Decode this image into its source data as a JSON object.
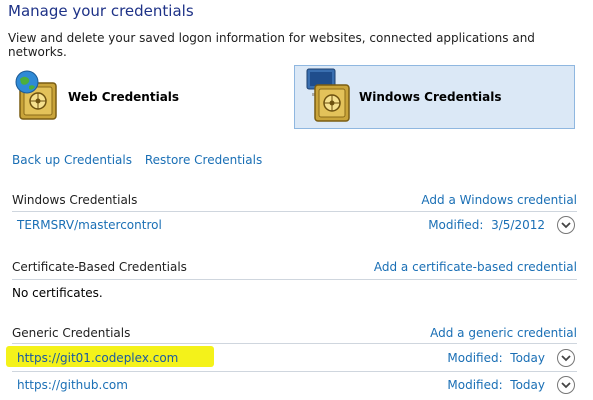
{
  "header": {
    "title": "Manage your credentials",
    "subtitle": "View and delete your saved logon information for websites, connected applications and networks."
  },
  "types": {
    "web_label": "Web Credentials",
    "windows_label": "Windows Credentials"
  },
  "actions": {
    "backup": "Back up Credentials",
    "restore": "Restore Credentials"
  },
  "sections": {
    "windows": {
      "heading": "Windows Credentials",
      "add_link": "Add a Windows credential",
      "items": [
        {
          "name": "TERMSRV/mastercontrol",
          "modified_label": "Modified:",
          "modified_value": "3/5/2012"
        }
      ]
    },
    "certificate": {
      "heading": "Certificate-Based Credentials",
      "add_link": "Add a certificate-based credential",
      "empty_text": "No certificates."
    },
    "generic": {
      "heading": "Generic Credentials",
      "add_link": "Add a generic credential",
      "items": [
        {
          "name": "https://git01.codeplex.com",
          "modified_label": "Modified:",
          "modified_value": "Today"
        },
        {
          "name": "https://github.com",
          "modified_label": "Modified:",
          "modified_value": "Today"
        }
      ]
    }
  },
  "colors": {
    "link": "#1a6fb5",
    "title": "#1e3287",
    "selected_bg": "#dbe8f6",
    "highlight": "#f4f21a"
  },
  "icons": {
    "web": "globe-vault-icon",
    "windows": "monitor-vault-icon",
    "expand": "chevron-down-icon"
  }
}
